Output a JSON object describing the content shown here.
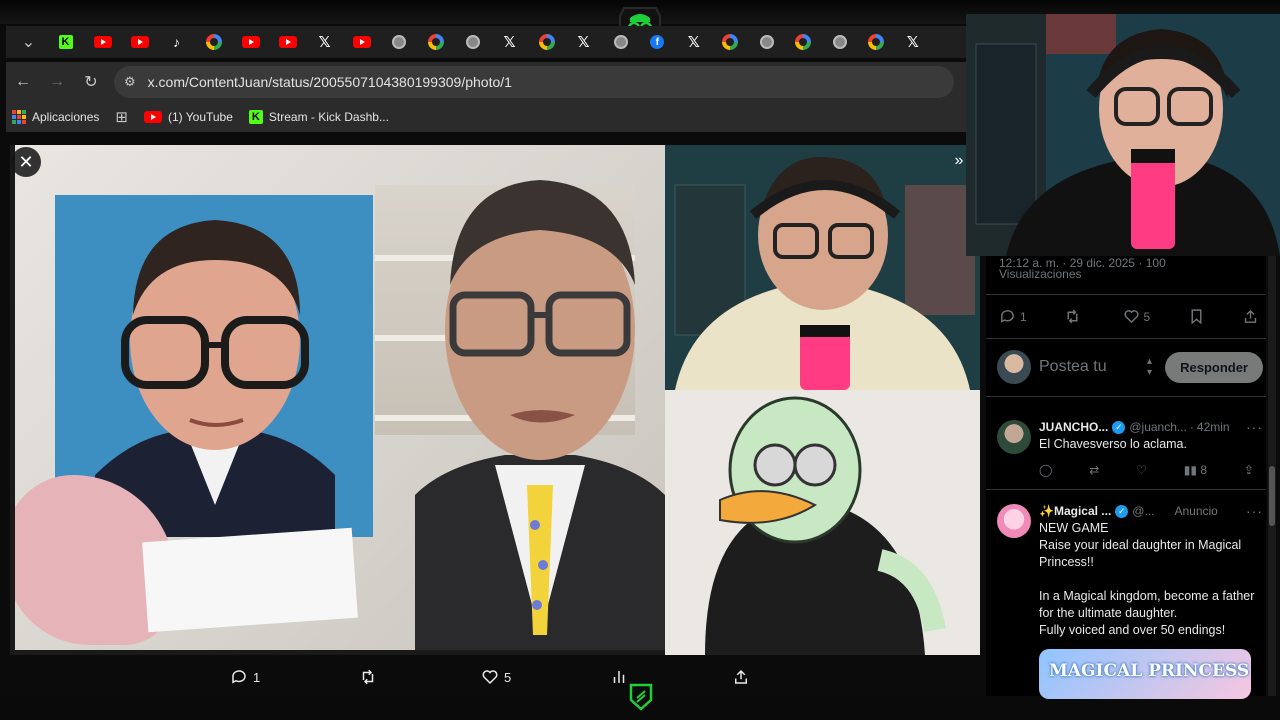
{
  "browser": {
    "tabs": [
      {
        "icon": "chevron-down-icon"
      },
      {
        "icon": "kick-icon"
      },
      {
        "icon": "youtube-icon"
      },
      {
        "icon": "youtube-icon"
      },
      {
        "icon": "tiktok-icon"
      },
      {
        "icon": "google-icon"
      },
      {
        "icon": "youtube-icon"
      },
      {
        "icon": "youtube-icon"
      },
      {
        "icon": "x-icon"
      },
      {
        "icon": "youtube-icon"
      },
      {
        "icon": "chrome-icon"
      },
      {
        "icon": "google-icon"
      },
      {
        "icon": "globe-icon"
      },
      {
        "icon": "x-icon"
      },
      {
        "icon": "google-icon"
      },
      {
        "icon": "x-icon"
      },
      {
        "icon": "globe-icon"
      },
      {
        "icon": "facebook-icon"
      },
      {
        "icon": "x-icon"
      },
      {
        "icon": "google-icon"
      },
      {
        "icon": "globe-icon"
      },
      {
        "icon": "google-icon"
      },
      {
        "icon": "globe-icon"
      },
      {
        "icon": "google-icon"
      },
      {
        "icon": "x-icon"
      }
    ],
    "url": "x.com/ContentJuan/status/2005507104380199309/photo/1",
    "bookmarks": {
      "apps_label": "Aplicaciones",
      "youtube_label": "(1) YouTube",
      "kick_label": "Stream - Kick Dashb..."
    }
  },
  "viewer": {
    "actions": {
      "replies": "1",
      "reposts": "",
      "likes": "5",
      "views": ""
    }
  },
  "tweet": {
    "meta": "12:12 a. m. · 29 dic. 2025 · 100",
    "views_label": "Visualizaciones",
    "actions": {
      "replies": "1",
      "reposts": "",
      "likes": "5"
    },
    "reply_placeholder": "Postea tu",
    "reply_button": "Responder"
  },
  "replies": [
    {
      "name": "JUANCHO...",
      "handle": "@juanch...",
      "time": "42min",
      "text": "El Chavesverso lo aclama.",
      "views": "8"
    },
    {
      "name": "✨Magical ...",
      "handle": "@...",
      "time": "Anuncio",
      "text": "NEW GAME\nRaise your ideal daughter in Magical Princess!!\n\nIn a Magical kingdom, become a father for the ultimate daughter.\nFully voiced and over 50 endings!",
      "banner": "MAGICAL PRINCESS"
    }
  ],
  "colors": {
    "accent_green": "#53fc18",
    "x_blue": "#1d9bf0",
    "youtube_red": "#ff0000"
  }
}
